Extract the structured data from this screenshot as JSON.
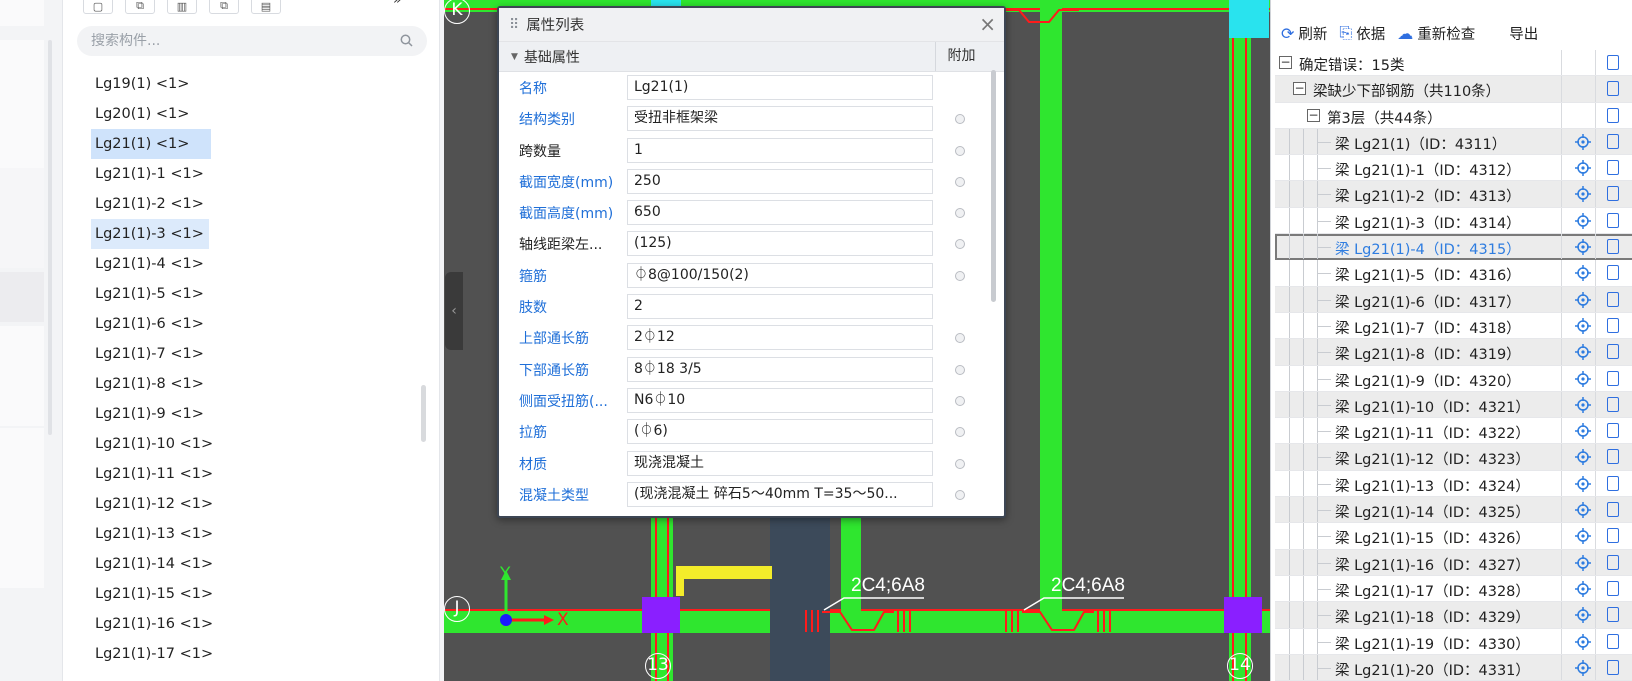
{
  "component_panel": {
    "search_placeholder": "搜索构件...",
    "items": [
      {
        "label": "Lg19(1) <1>",
        "selected": false
      },
      {
        "label": "Lg20(1) <1>",
        "selected": false
      },
      {
        "label": "Lg21(1) <1>",
        "selected": true
      },
      {
        "label": "Lg21(1)-1 <1>",
        "selected": false
      },
      {
        "label": "Lg21(1)-2 <1>",
        "selected": false
      },
      {
        "label": "Lg21(1)-3 <1>",
        "selected": true
      },
      {
        "label": "Lg21(1)-4 <1>",
        "selected": false
      },
      {
        "label": "Lg21(1)-5 <1>",
        "selected": false
      },
      {
        "label": "Lg21(1)-6 <1>",
        "selected": false
      },
      {
        "label": "Lg21(1)-7 <1>",
        "selected": false
      },
      {
        "label": "Lg21(1)-8 <1>",
        "selected": false
      },
      {
        "label": "Lg21(1)-9 <1>",
        "selected": false
      },
      {
        "label": "Lg21(1)-10 <1>",
        "selected": false
      },
      {
        "label": "Lg21(1)-11 <1>",
        "selected": false
      },
      {
        "label": "Lg21(1)-12 <1>",
        "selected": false
      },
      {
        "label": "Lg21(1)-13 <1>",
        "selected": false
      },
      {
        "label": "Lg21(1)-14 <1>",
        "selected": false
      },
      {
        "label": "Lg21(1)-15 <1>",
        "selected": false
      },
      {
        "label": "Lg21(1)-16 <1>",
        "selected": false
      },
      {
        "label": "Lg21(1)-17 <1>",
        "selected": false
      }
    ]
  },
  "canvas": {
    "axis_k": "K",
    "axis_j": "J",
    "axis_13": "13",
    "axis_14": "14",
    "y_label": "Y",
    "x_label": "X",
    "beam_label_1": "2C4;6A8",
    "beam_label_2": "2C4;6A8",
    "colors": {
      "background": "#515151",
      "beam": "#2fe62f",
      "rebar": "#ff1b1b",
      "column": "#8a1fff"
    }
  },
  "property_dialog": {
    "title": "属性列表",
    "group_label": "基础属性",
    "extra_header": "附加",
    "rows": [
      {
        "name": "名称",
        "value": "Lg21(1)",
        "blue": true,
        "radio": false
      },
      {
        "name": "结构类别",
        "value": "受扭非框架梁",
        "blue": true,
        "radio": true
      },
      {
        "name": "跨数量",
        "value": "1",
        "blue": false,
        "radio": true
      },
      {
        "name": "截面宽度(mm)",
        "value": "250",
        "blue": true,
        "radio": true
      },
      {
        "name": "截面高度(mm)",
        "value": "650",
        "blue": true,
        "radio": true
      },
      {
        "name": "轴线距梁左...",
        "value": "(125)",
        "blue": false,
        "radio": true
      },
      {
        "name": "箍筋",
        "value": "⏀8@100/150(2)",
        "blue": true,
        "radio": true
      },
      {
        "name": "肢数",
        "value": "2",
        "blue": true,
        "radio": false
      },
      {
        "name": "上部通长筋",
        "value": "2⏀12",
        "blue": true,
        "radio": true
      },
      {
        "name": "下部通长筋",
        "value": "8⏀18 3/5",
        "blue": true,
        "radio": true
      },
      {
        "name": "侧面受扭筋(...",
        "value": "N6⏀10",
        "blue": true,
        "radio": true
      },
      {
        "name": "拉筋",
        "value": "(⏀6)",
        "blue": true,
        "radio": true
      },
      {
        "name": "材质",
        "value": "现浇混凝土",
        "blue": true,
        "radio": true
      },
      {
        "name": "混凝土类型",
        "value": "(现浇混凝土 碎石5～40mm T=35～50...",
        "blue": true,
        "radio": true
      }
    ]
  },
  "result_panel": {
    "refresh_label": "刷新",
    "basis_label": "依据",
    "recheck_label": "重新检查",
    "export_label": "导出",
    "tree": [
      {
        "label": "确定错误：15类",
        "level": 0,
        "box": "−",
        "alt": false,
        "locate": false
      },
      {
        "label": "梁缺少下部钢筋（共110条）",
        "level": 1,
        "box": "−",
        "alt": true,
        "locate": false
      },
      {
        "label": "第3层（共44条）",
        "level": 2,
        "box": "−",
        "alt": false,
        "locate": false
      },
      {
        "label": "梁 Lg21(1)（ID：4311）",
        "level": 3,
        "alt": true,
        "locate": true
      },
      {
        "label": "梁 Lg21(1)-1（ID：4312）",
        "level": 3,
        "alt": false,
        "locate": true
      },
      {
        "label": "梁 Lg21(1)-2（ID：4313）",
        "level": 3,
        "alt": true,
        "locate": true
      },
      {
        "label": "梁 Lg21(1)-3（ID：4314）",
        "level": 3,
        "alt": false,
        "locate": true
      },
      {
        "label": "梁 Lg21(1)-4（ID：4315）",
        "level": 3,
        "alt": true,
        "locate": true,
        "selected": true
      },
      {
        "label": "梁 Lg21(1)-5（ID：4316）",
        "level": 3,
        "alt": false,
        "locate": true
      },
      {
        "label": "梁 Lg21(1)-6（ID：4317）",
        "level": 3,
        "alt": true,
        "locate": true
      },
      {
        "label": "梁 Lg21(1)-7（ID：4318）",
        "level": 3,
        "alt": false,
        "locate": true
      },
      {
        "label": "梁 Lg21(1)-8（ID：4319）",
        "level": 3,
        "alt": true,
        "locate": true
      },
      {
        "label": "梁 Lg21(1)-9（ID：4320）",
        "level": 3,
        "alt": false,
        "locate": true
      },
      {
        "label": "梁 Lg21(1)-10（ID：4321）",
        "level": 3,
        "alt": true,
        "locate": true
      },
      {
        "label": "梁 Lg21(1)-11（ID：4322）",
        "level": 3,
        "alt": false,
        "locate": true
      },
      {
        "label": "梁 Lg21(1)-12（ID：4323）",
        "level": 3,
        "alt": true,
        "locate": true
      },
      {
        "label": "梁 Lg21(1)-13（ID：4324）",
        "level": 3,
        "alt": false,
        "locate": true
      },
      {
        "label": "梁 Lg21(1)-14（ID：4325）",
        "level": 3,
        "alt": true,
        "locate": true
      },
      {
        "label": "梁 Lg21(1)-15（ID：4326）",
        "level": 3,
        "alt": false,
        "locate": true
      },
      {
        "label": "梁 Lg21(1)-16（ID：4327）",
        "level": 3,
        "alt": true,
        "locate": true
      },
      {
        "label": "梁 Lg21(1)-17（ID：4328）",
        "level": 3,
        "alt": false,
        "locate": true
      },
      {
        "label": "梁 Lg21(1)-18（ID：4329）",
        "level": 3,
        "alt": true,
        "locate": true
      },
      {
        "label": "梁 Lg21(1)-19（ID：4330）",
        "level": 3,
        "alt": false,
        "locate": true
      },
      {
        "label": "梁 Lg21(1)-20（ID：4331）",
        "level": 3,
        "alt": true,
        "locate": true
      }
    ]
  }
}
